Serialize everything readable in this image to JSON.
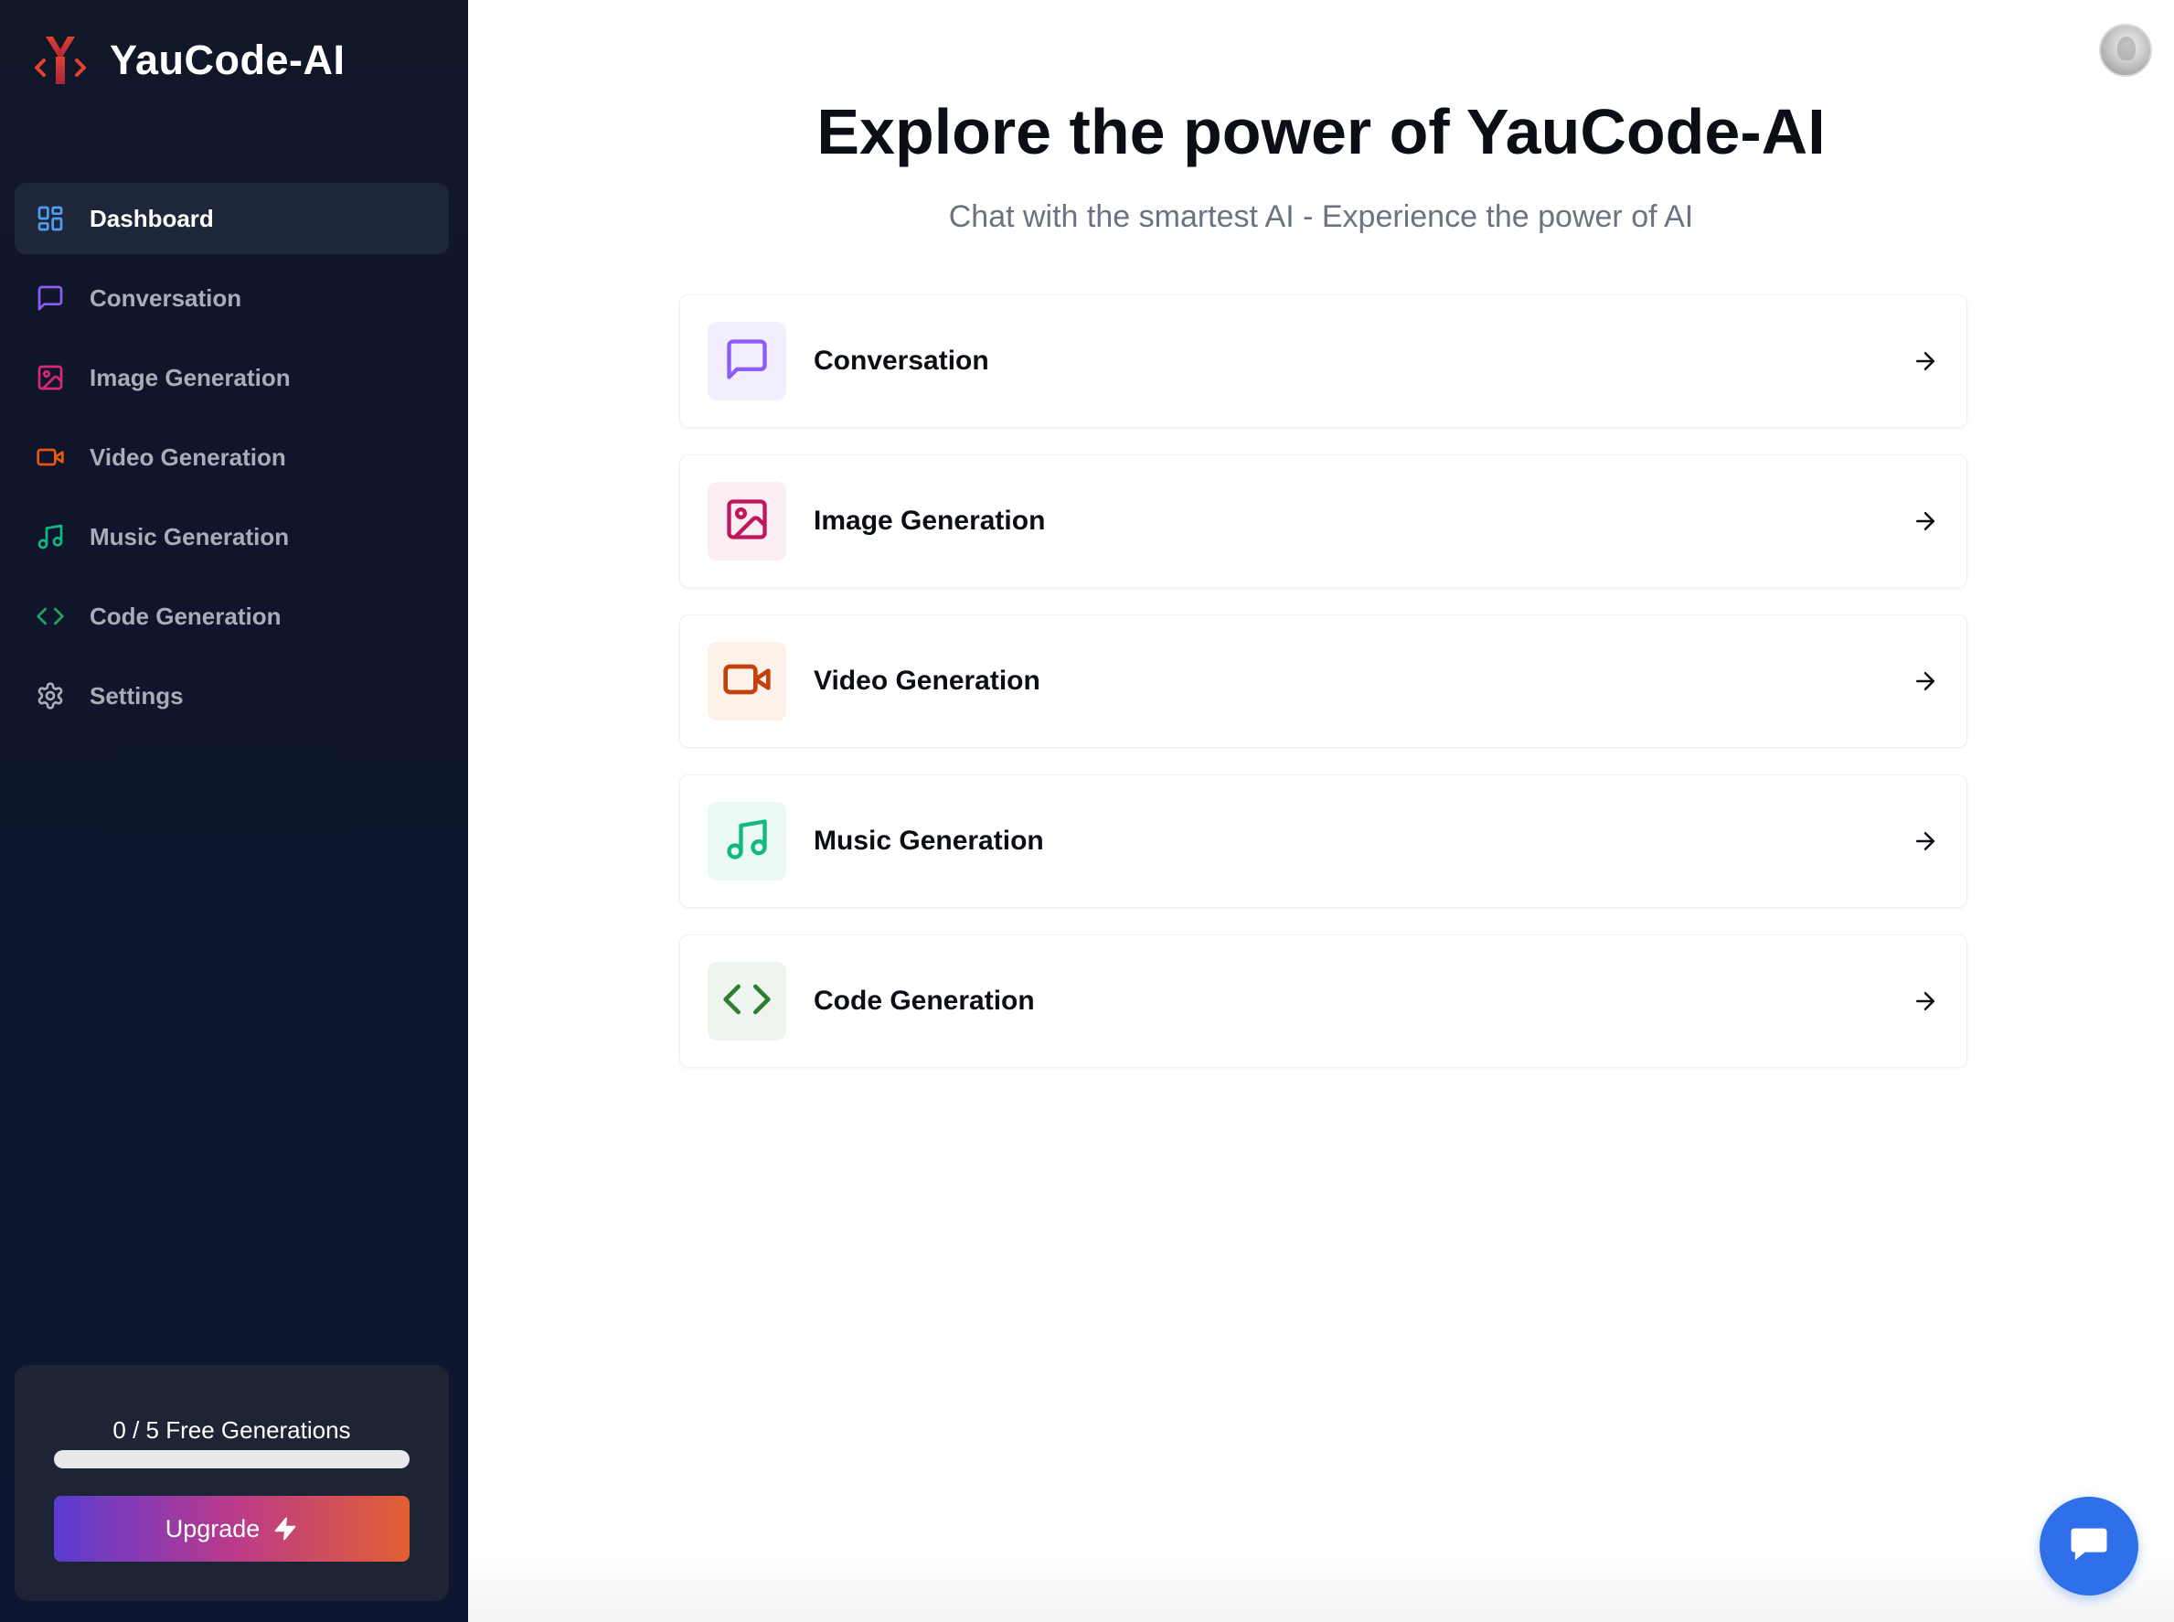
{
  "brand": {
    "name": "YauCode-AI"
  },
  "sidebar": {
    "items": [
      {
        "label": "Dashboard",
        "icon": "dashboard-grid-icon",
        "color": "#4f9df0",
        "active": true
      },
      {
        "label": "Conversation",
        "icon": "message-square-icon",
        "color": "#8b5cf6"
      },
      {
        "label": "Image Generation",
        "icon": "image-icon",
        "color": "#db2777"
      },
      {
        "label": "Video Generation",
        "icon": "video-icon",
        "color": "#ea580c"
      },
      {
        "label": "Music Generation",
        "icon": "music-icon",
        "color": "#10b981"
      },
      {
        "label": "Code Generation",
        "icon": "code-icon",
        "color": "#22a35a"
      },
      {
        "label": "Settings",
        "icon": "settings-gear-icon",
        "color": "#a8adb8"
      }
    ]
  },
  "usage": {
    "text": "0 / 5 Free Generations",
    "used": 0,
    "limit": 5,
    "upgrade_label": "Upgrade"
  },
  "hero": {
    "title": "Explore the power of YauCode-AI",
    "subtitle": "Chat with the smartest AI - Experience the power of AI"
  },
  "tools": [
    {
      "label": "Conversation",
      "icon": "message-square-icon",
      "color": "#8b5cf6",
      "bg": "#f2eefe"
    },
    {
      "label": "Image Generation",
      "icon": "image-icon",
      "color": "#be185d",
      "bg": "#fbeef2"
    },
    {
      "label": "Video Generation",
      "icon": "video-icon",
      "color": "#c2410c",
      "bg": "#fdf1ea"
    },
    {
      "label": "Music Generation",
      "icon": "music-icon",
      "color": "#10b981",
      "bg": "#ecf8f2"
    },
    {
      "label": "Code Generation",
      "icon": "code-icon",
      "color": "#2e7d32",
      "bg": "#eef5ee"
    }
  ]
}
